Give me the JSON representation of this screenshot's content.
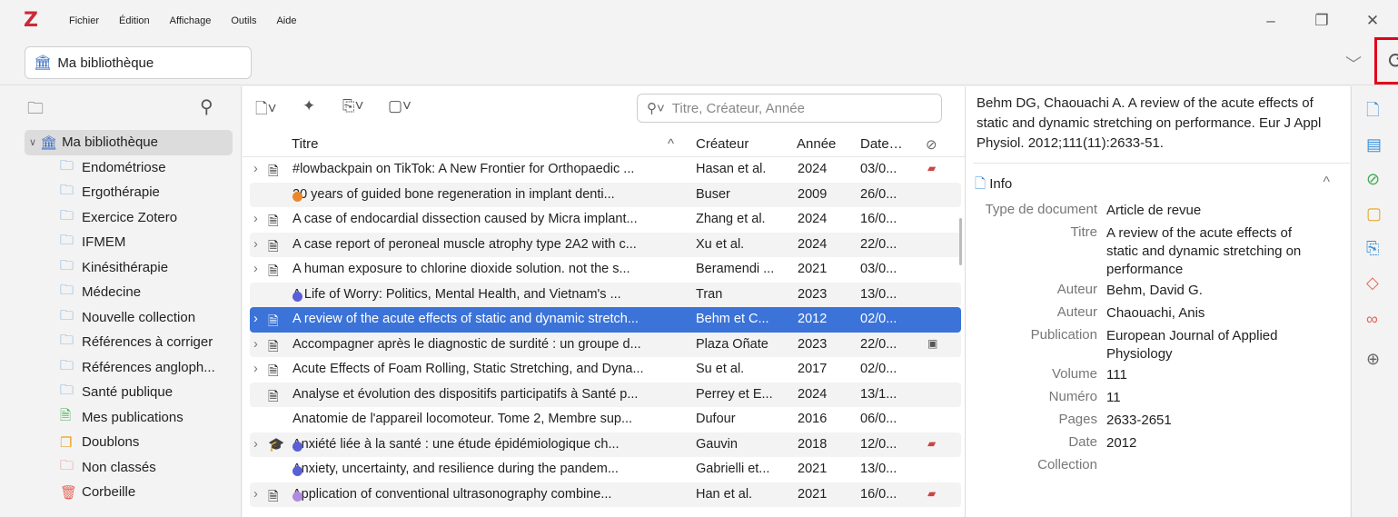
{
  "menu": [
    "Fichier",
    "Édition",
    "Affichage",
    "Outils",
    "Aide"
  ],
  "logo": "Z",
  "library_tab": "Ma bibliothèque",
  "search_placeholder": "Titre, Créateur, Année",
  "columns": {
    "title": "Titre",
    "creator": "Créateur",
    "year": "Année",
    "date": "Date…"
  },
  "tree": {
    "root": "Ma bibliothèque",
    "items": [
      {
        "label": "Endométriose",
        "icon": "folder-icon"
      },
      {
        "label": "Ergothérapie",
        "icon": "folder-icon"
      },
      {
        "label": "Exercice Zotero",
        "icon": "folder-icon"
      },
      {
        "label": "IFMEM",
        "icon": "folder-icon"
      },
      {
        "label": "Kinésithérapie",
        "icon": "folder-icon"
      },
      {
        "label": "Médecine",
        "icon": "folder-icon"
      },
      {
        "label": "Nouvelle collection",
        "icon": "folder-icon"
      },
      {
        "label": "Références à corriger",
        "icon": "folder-icon"
      },
      {
        "label": "Références angloph...",
        "icon": "folder-icon"
      },
      {
        "label": "Santé publique",
        "icon": "folder-icon"
      },
      {
        "label": "Mes publications",
        "icon": "publications-icon"
      },
      {
        "label": "Doublons",
        "icon": "duplicates-icon"
      },
      {
        "label": "Non classés",
        "icon": "unfiled-icon"
      },
      {
        "label": "Corbeille",
        "icon": "trash-icon"
      }
    ]
  },
  "rows": [
    {
      "arrow": "›",
      "type": "doc",
      "dot": "",
      "title": "#lowbackpain on TikTok: A New Frontier for Orthopaedic ...",
      "creator": "Hasan et al.",
      "year": "2024",
      "date": "03/0...",
      "att": "pdf"
    },
    {
      "arrow": "",
      "type": "book",
      "dot": "#e8892b",
      "title": "20 years of guided bone regeneration in implant denti...",
      "creator": "Buser",
      "year": "2009",
      "date": "26/0...",
      "att": ""
    },
    {
      "arrow": "›",
      "type": "doc",
      "dot": "",
      "title": "A case of endocardial dissection caused by Micra implant...",
      "creator": "Zhang et al.",
      "year": "2024",
      "date": "16/0...",
      "att": ""
    },
    {
      "arrow": "›",
      "type": "doc",
      "dot": "",
      "title": "A case report of peroneal muscle atrophy type 2A2 with c...",
      "creator": "Xu et al.",
      "year": "2024",
      "date": "22/0...",
      "att": ""
    },
    {
      "arrow": "›",
      "type": "doc",
      "dot": "",
      "title": "A human exposure to chlorine dioxide solution. not the s...",
      "creator": "Beramendi ...",
      "year": "2021",
      "date": "03/0...",
      "att": ""
    },
    {
      "arrow": "",
      "type": "book",
      "dot": "#5b5fd6",
      "title": "A Life of Worry: Politics, Mental Health, and Vietnam's ...",
      "creator": "Tran",
      "year": "2023",
      "date": "13/0...",
      "att": ""
    },
    {
      "arrow": "›",
      "type": "doc",
      "dot": "",
      "title": "A review of the acute effects of static and dynamic stretch...",
      "creator": "Behm et C...",
      "year": "2012",
      "date": "02/0...",
      "att": "",
      "selected": true
    },
    {
      "arrow": "›",
      "type": "doc",
      "dot": "",
      "title": "Accompagner après le diagnostic de surdité : un groupe d...",
      "creator": "Plaza Oñate",
      "year": "2023",
      "date": "22/0...",
      "att": "snap"
    },
    {
      "arrow": "›",
      "type": "doc",
      "dot": "",
      "title": "Acute Effects of Foam Rolling, Static Stretching, and Dyna...",
      "creator": "Su et al.",
      "year": "2017",
      "date": "02/0...",
      "att": ""
    },
    {
      "arrow": "",
      "type": "doc",
      "dot": "",
      "title": "Analyse et évolution des dispositifs participatifs à Santé p...",
      "creator": "Perrey et E...",
      "year": "2024",
      "date": "13/1...",
      "att": ""
    },
    {
      "arrow": "",
      "type": "book",
      "dot": "",
      "title": "Anatomie de l'appareil locomoteur. Tome 2, Membre sup...",
      "creator": "Dufour",
      "year": "2016",
      "date": "06/0...",
      "att": ""
    },
    {
      "arrow": "›",
      "type": "thesis",
      "dot": "#5b5fd6",
      "title": "Anxiété liée à la santé : une étude épidémiologique ch...",
      "creator": "Gauvin",
      "year": "2018",
      "date": "12/0...",
      "att": "pdf"
    },
    {
      "arrow": "",
      "type": "book",
      "dot": "#5b5fd6",
      "title": "Anxiety, uncertainty, and resilience during the pandem...",
      "creator": "Gabrielli et...",
      "year": "2021",
      "date": "13/0...",
      "att": ""
    },
    {
      "arrow": "›",
      "type": "doc",
      "dot": "#b08be0",
      "title": "Application of conventional ultrasonography combine...",
      "creator": "Han et al.",
      "year": "2021",
      "date": "16/0...",
      "att": "pdf"
    }
  ],
  "citation": "Behm DG, Chaouachi A. A review of the acute effects of static and dynamic stretching on performance. Eur J Appl Physiol. 2012;111(11):2633-51.",
  "info_label": "Info",
  "fields": [
    {
      "k": "Type de document",
      "v": "Article de revue"
    },
    {
      "k": "Titre",
      "v": "A review of the acute effects of static and dynamic stretching on performance"
    },
    {
      "k": "Auteur",
      "v": "Behm, David G."
    },
    {
      "k": "Auteur",
      "v": "Chaouachi, Anis"
    },
    {
      "k": "Publication",
      "v": "European Journal of Applied Physiology"
    },
    {
      "k": "Volume",
      "v": "111"
    },
    {
      "k": "Numéro",
      "v": "11"
    },
    {
      "k": "Pages",
      "v": "2633-2651"
    },
    {
      "k": "Date",
      "v": "2012"
    },
    {
      "k": "Collection",
      "v": ""
    }
  ],
  "colors": {
    "accent": "#3b73d9",
    "highlight": "#e3001b",
    "logo": "#cc2936"
  }
}
